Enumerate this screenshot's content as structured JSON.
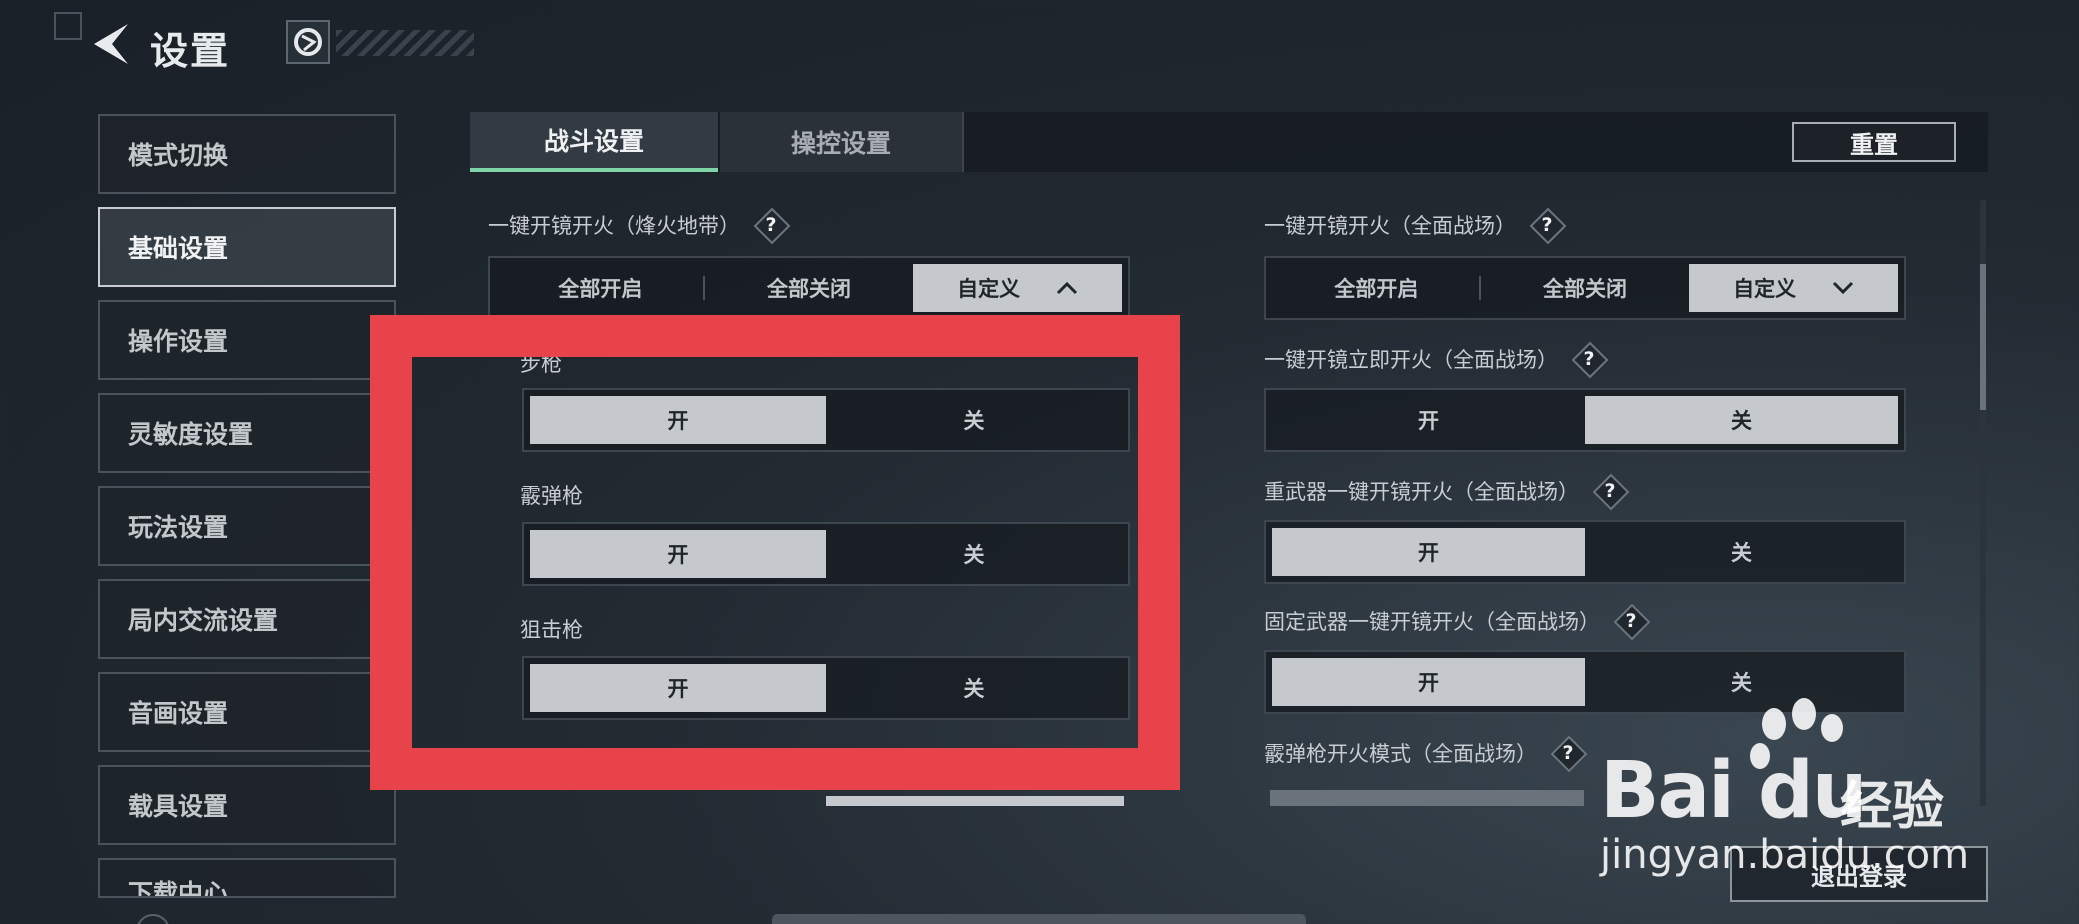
{
  "header": {
    "title": "设置"
  },
  "sidebar": {
    "items": [
      {
        "label": "模式切换"
      },
      {
        "label": "基础设置"
      },
      {
        "label": "操作设置"
      },
      {
        "label": "灵敏度设置"
      },
      {
        "label": "玩法设置"
      },
      {
        "label": "局内交流设置"
      },
      {
        "label": "音画设置"
      },
      {
        "label": "载具设置"
      },
      {
        "label": "下载中心"
      }
    ],
    "active_index": 1
  },
  "tabs": [
    {
      "label": "战斗设置",
      "active": true
    },
    {
      "label": "操控设置",
      "active": false
    }
  ],
  "reset_label": "重置",
  "help_glyph": "?",
  "left_col": {
    "top": {
      "label": "一键开镜开火（烽火地带）",
      "options": [
        "全部开启",
        "全部关闭",
        "自定义"
      ],
      "selected": 2,
      "chevron": "up"
    },
    "subs": [
      {
        "label": "步枪",
        "on": "开",
        "off": "关",
        "value": "on"
      },
      {
        "label": "霰弹枪",
        "on": "开",
        "off": "关",
        "value": "on"
      },
      {
        "label": "狙击枪",
        "on": "开",
        "off": "关",
        "value": "on"
      }
    ]
  },
  "right_col": {
    "top": {
      "label": "一键开镜开火（全面战场）",
      "options": [
        "全部开启",
        "全部关闭",
        "自定义"
      ],
      "selected": 2,
      "chevron": "down"
    },
    "toggles": [
      {
        "label": "一键开镜立即开火（全面战场）",
        "on": "开",
        "off": "关",
        "value": "off"
      },
      {
        "label": "重武器一键开镜开火（全面战场）",
        "on": "开",
        "off": "关",
        "value": "on"
      },
      {
        "label": "固定武器一键开镜开火（全面战场）",
        "on": "开",
        "off": "关",
        "value": "on"
      },
      {
        "label": "霰弹枪开火模式（全面战场）"
      }
    ]
  },
  "logout_label": "退出登录",
  "watermark": {
    "brand": "Bai du",
    "jingyan": "经验",
    "url": "jingyan.baidu.com"
  },
  "colors": {
    "accent": "#7fd4a8",
    "highlight_frame": "#e8424a",
    "selected_bg": "#c5c9cd"
  }
}
